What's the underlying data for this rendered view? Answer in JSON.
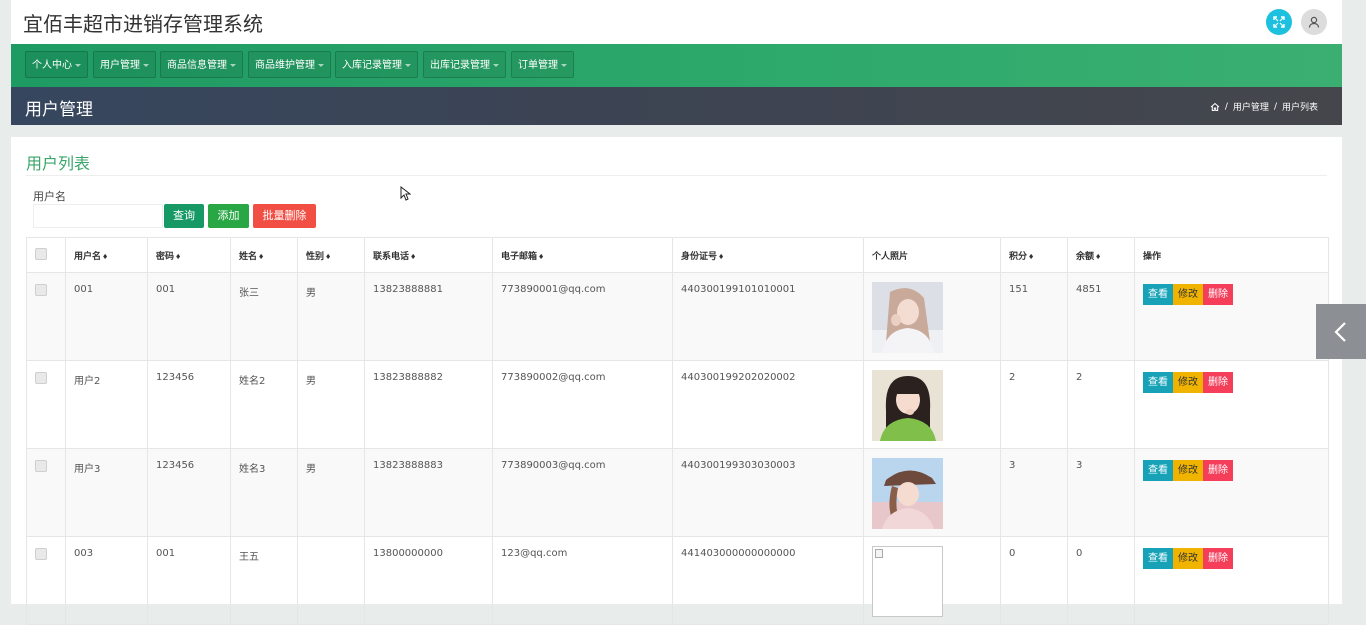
{
  "app": {
    "title": "宜佰丰超市进销存管理系统"
  },
  "topbar_icons": {
    "fullscreen": "fullscreen-icon",
    "user": "user-icon"
  },
  "nav": {
    "items": [
      {
        "label": "个人中心"
      },
      {
        "label": "用户管理"
      },
      {
        "label": "商品信息管理"
      },
      {
        "label": "商品维护管理"
      },
      {
        "label": "入库记录管理"
      },
      {
        "label": "出库记录管理"
      },
      {
        "label": "订单管理"
      }
    ]
  },
  "page_header": {
    "title": "用户管理",
    "breadcrumb": [
      "用户管理",
      "用户列表"
    ]
  },
  "list": {
    "title": "用户列表",
    "filter": {
      "label": "用户名",
      "value": "",
      "placeholder": ""
    },
    "buttons": {
      "query": "查询",
      "add": "添加",
      "batch_delete": "批量删除"
    },
    "columns": [
      "用户名",
      "密码",
      "姓名",
      "性别",
      "联系电话",
      "电子邮箱",
      "身份证号",
      "个人照片",
      "积分",
      "余额",
      "操作"
    ],
    "rows": [
      {
        "username": "001",
        "password": "001",
        "name": "张三",
        "gender": "男",
        "phone": "13823888881",
        "email": "773890001@qq.com",
        "id_number": "440300199101010001",
        "photo": "photo-woman-light-hair",
        "points": "151",
        "balance": "4851"
      },
      {
        "username": "用户2",
        "password": "123456",
        "name": "姓名2",
        "gender": "男",
        "phone": "13823888882",
        "email": "773890002@qq.com",
        "id_number": "440300199202020002",
        "photo": "photo-girl-green-shirt",
        "points": "2",
        "balance": "2"
      },
      {
        "username": "用户3",
        "password": "123456",
        "name": "姓名3",
        "gender": "男",
        "phone": "13823888883",
        "email": "773890003@qq.com",
        "id_number": "440300199303030003",
        "photo": "photo-girl-cap",
        "points": "3",
        "balance": "3"
      },
      {
        "username": "003",
        "password": "001",
        "name": "王五",
        "gender": "",
        "phone": "13800000000",
        "email": "123@qq.com",
        "id_number": "441403000000000000",
        "photo": "broken-image",
        "points": "0",
        "balance": "0"
      }
    ],
    "row_actions": {
      "view": "查看",
      "edit": "修改",
      "delete": "删除"
    }
  },
  "colors": {
    "nav_green": "#2eaa6c",
    "header_dark": "#3d4452",
    "title_green": "#3aa66a",
    "btn_query": "#169965",
    "btn_add": "#29a745",
    "btn_delete": "#f24f44",
    "op_view": "#17a2b8",
    "op_edit": "#f0b400",
    "op_delete": "#f43e5a"
  }
}
